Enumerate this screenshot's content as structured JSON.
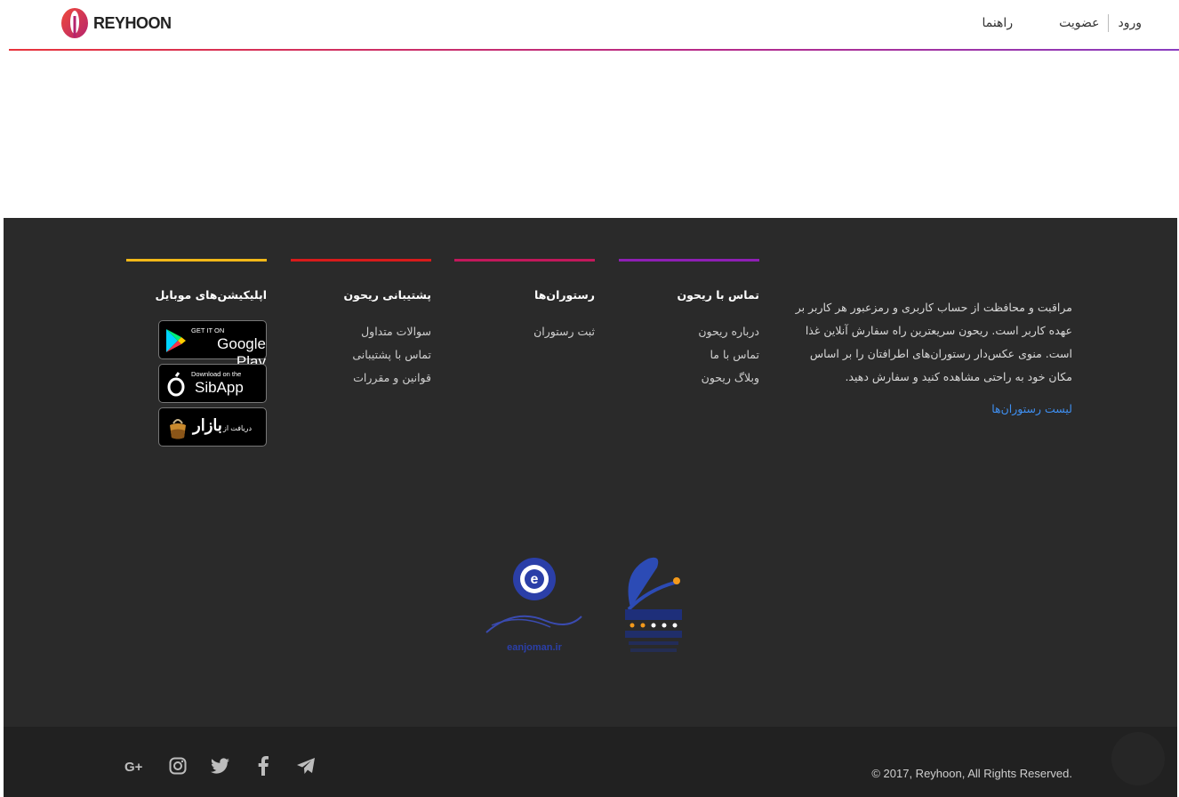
{
  "header": {
    "logo_text": "REYHOON",
    "nav": {
      "login": "ورود",
      "signup": "عضویت",
      "help": "راهنما"
    }
  },
  "footer": {
    "about": {
      "text": "مراقبت و محافظت از حساب کاربری و رمزعبور هر کاربر بر عهده کاربر است. ریحون سریعترین راه سفارش آنلاین غذا است. منوی عکس‌دار رستوران‌های اطرافتان را بر اساس مکان خود به راحتی مشاهده کنید و سفارش دهید.",
      "link": "لیست رستوران‌ها"
    },
    "columns": {
      "contact": {
        "title": "تماس با ریحون",
        "items": [
          "درباره ریحون",
          "تماس با ما",
          "وبلاگ ریحون"
        ],
        "color": "#8e1fb4"
      },
      "restaurants": {
        "title": "رستوران‌ها",
        "items": [
          "ثبت رستوران"
        ],
        "color": "#c2185b"
      },
      "support": {
        "title": "پشتیبانی ریحون",
        "items": [
          "سوالات متداول",
          "تماس با پشتیبانی",
          "قوانین و مقررات"
        ],
        "color": "#d81b1b"
      },
      "apps": {
        "title": "اپلیکیشن‌های موبایل",
        "color": "#f2b818"
      }
    },
    "stores": {
      "google_small": "GET IT ON",
      "google_big": "Google Play",
      "sib_small": "Download on the",
      "sib_big": "SibApp",
      "bazaar_small": "دریافت از",
      "bazaar_big": "بازار"
    },
    "badges": {
      "enamad_icon": "enamad-badge",
      "eanjoman_caption": "eanjoman.ir"
    }
  },
  "bottom": {
    "copyright": "© 2017, Reyhoon, All Rights Reserved.",
    "social": [
      "google-plus-icon",
      "instagram-icon",
      "twitter-icon",
      "facebook-icon",
      "telegram-icon"
    ]
  }
}
